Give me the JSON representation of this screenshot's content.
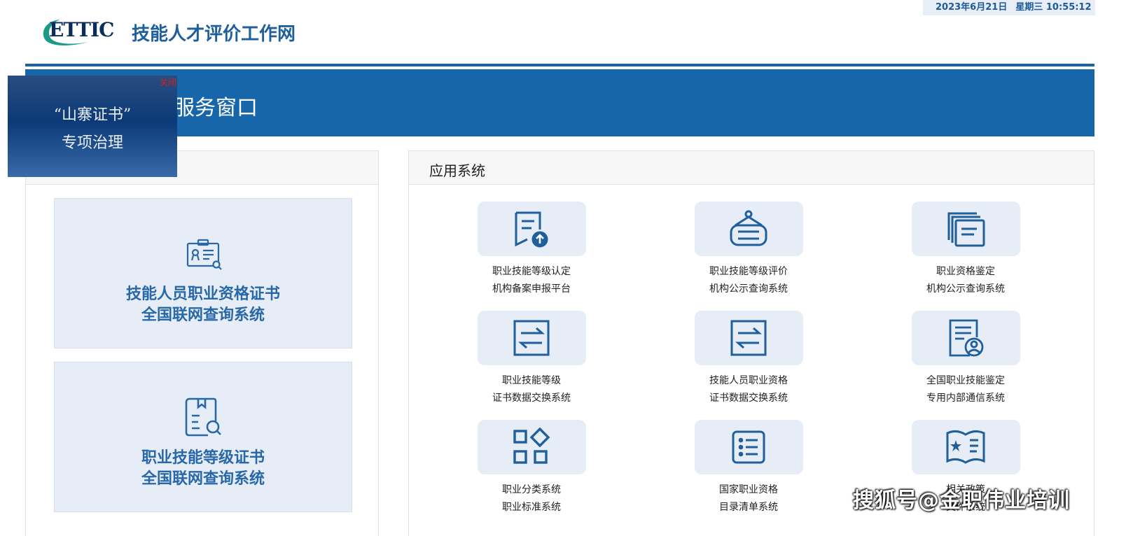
{
  "header": {
    "logo_text": "ETTIC",
    "site_title": "技能人才评价工作网",
    "date": "2023年6月21日",
    "weekday_time": "星期三 10:55:12"
  },
  "banner": {
    "title": "服务窗口"
  },
  "popup": {
    "close_label": "关闭",
    "line1": "“山寨证书”",
    "line2": "专项治理"
  },
  "left_cards": [
    {
      "line1": "技能人员职业资格证书",
      "line2": "全国联网查询系统"
    },
    {
      "line1": "职业技能等级证书",
      "line2": "全国联网查询系统"
    }
  ],
  "apps_section": {
    "title": "应用系统",
    "apps": [
      {
        "icon": "document-upload-icon",
        "line1": "职业技能等级认定",
        "line2": "机构备案申报平台"
      },
      {
        "icon": "hanging-sign-icon",
        "line1": "职业技能等级评价",
        "line2": "机构公示查询系统"
      },
      {
        "icon": "stacked-documents-icon",
        "line1": "职业资格鉴定",
        "line2": "机构公示查询系统"
      },
      {
        "icon": "exchange-icon",
        "line1": "职业技能等级",
        "line2": "证书数据交换系统"
      },
      {
        "icon": "exchange-icon",
        "line1": "技能人员职业资格",
        "line2": "证书数据交换系统"
      },
      {
        "icon": "document-user-icon",
        "line1": "全国职业技能鉴定",
        "line2": "专用内部通信系统"
      },
      {
        "icon": "category-grid-icon",
        "line1": "职业分类系统",
        "line2": "职业标准系统"
      },
      {
        "icon": "list-icon",
        "line1": "国家职业资格",
        "line2": "目录清单系统"
      },
      {
        "icon": "star-book-icon",
        "line1": "相关政策",
        "line2": "文件系统"
      }
    ]
  },
  "watermark": "搜狐号@金职伟业培训",
  "colors": {
    "brand_blue": "#1766aa",
    "title_blue": "#1f5f9c",
    "tile_bg": "#e6edf6",
    "close_red": "#d32020"
  }
}
